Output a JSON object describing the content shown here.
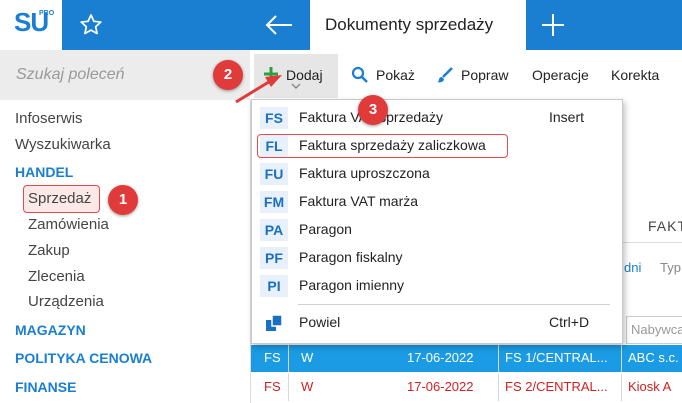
{
  "header": {
    "logo_text": "SU",
    "logo_superscript": "PRO",
    "document_tab_title": "Dokumenty sprzedaży"
  },
  "search": {
    "placeholder": "Szukaj poleceń"
  },
  "sidebar": {
    "items": [
      {
        "label": "Infoserwis",
        "type": "item"
      },
      {
        "label": "Wyszukiwarka",
        "type": "item"
      },
      {
        "label": "HANDEL",
        "type": "section"
      },
      {
        "label": "Sprzedaż",
        "type": "sub",
        "selected": true
      },
      {
        "label": "Zamówienia",
        "type": "sub"
      },
      {
        "label": "Zakup",
        "type": "sub"
      },
      {
        "label": "Zlecenia",
        "type": "sub"
      },
      {
        "label": "Urządzenia",
        "type": "sub"
      },
      {
        "label": "MAGAZYN",
        "type": "section"
      },
      {
        "label": "POLITYKA CENOWA",
        "type": "section"
      },
      {
        "label": "FINANSE",
        "type": "section"
      }
    ]
  },
  "toolbar": {
    "add": "Dodaj",
    "show": "Pokaż",
    "edit": "Popraw",
    "operations": "Operacje",
    "correction": "Korekta"
  },
  "menu": {
    "items": [
      {
        "code": "FS",
        "label": "Faktura VAT sprzedaży",
        "shortcut": "Insert"
      },
      {
        "code": "FL",
        "label": "Faktura sprzedaży zaliczkowa",
        "shortcut": ""
      },
      {
        "code": "FU",
        "label": "Faktura uproszczona",
        "shortcut": ""
      },
      {
        "code": "FM",
        "label": "Faktura VAT marża",
        "shortcut": ""
      },
      {
        "code": "PA",
        "label": "Paragon",
        "shortcut": ""
      },
      {
        "code": "PF",
        "label": "Paragon fiskalny",
        "shortcut": ""
      },
      {
        "code": "PI",
        "label": "Paragon imienny",
        "shortcut": ""
      }
    ],
    "duplicate": {
      "label": "Powiel",
      "shortcut": "Ctrl+D"
    }
  },
  "background": {
    "tab_label": "FAKT",
    "filter_days": "dni",
    "filter_type": "Typ",
    "buyer_placeholder": "Nabywca",
    "rows": [
      {
        "type": "FS",
        "status": "W",
        "date": "17-06-2022",
        "number": "FS 1/CENTRAL...",
        "buyer": "ABC s.c.",
        "selected": true
      },
      {
        "type": "FS",
        "status": "W",
        "date": "17-06-2022",
        "number": "FS 2/CENTRAL...",
        "buyer": "Kiosk A",
        "selected": false
      }
    ]
  },
  "annotations": {
    "step1": "1",
    "step2": "2",
    "step3": "3"
  },
  "colors": {
    "brand_blue": "#1a7fd0",
    "annotation_red": "#e03a3a",
    "selected_row": "#1a9be3",
    "add_icon_green": "#2e9e3e",
    "error_red": "#d32020"
  },
  "icons": {
    "star": "star-icon",
    "back": "back-arrow-icon",
    "new_tab": "plus-icon",
    "add": "add-icon",
    "show": "search-icon",
    "edit": "brush-icon",
    "duplicate": "duplicate-icon"
  }
}
